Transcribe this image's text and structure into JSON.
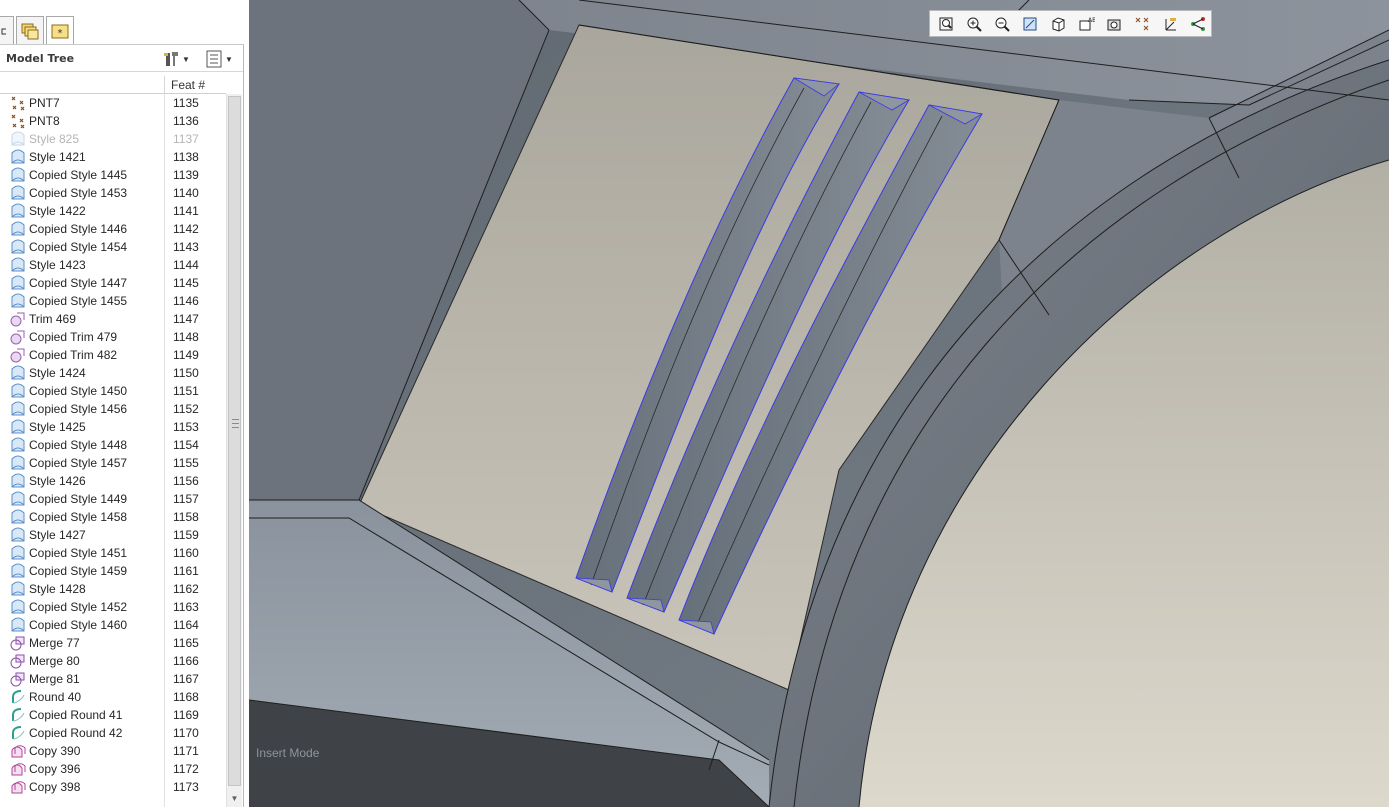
{
  "panel": {
    "header_title": "Model Tree",
    "feat_column_label": "Feat #"
  },
  "tree": {
    "rows": [
      {
        "name": "PNT7",
        "num": "1135",
        "icon": "datum-point-icon",
        "suppressed": false
      },
      {
        "name": "PNT8",
        "num": "1136",
        "icon": "datum-point-icon",
        "suppressed": false
      },
      {
        "name": "Style 825",
        "num": "1137",
        "icon": "style-icon",
        "suppressed": true
      },
      {
        "name": "Style 1421",
        "num": "1138",
        "icon": "style-icon",
        "suppressed": false
      },
      {
        "name": "Copied Style 1445",
        "num": "1139",
        "icon": "style-icon",
        "suppressed": false
      },
      {
        "name": "Copied Style 1453",
        "num": "1140",
        "icon": "style-icon",
        "suppressed": false
      },
      {
        "name": "Style 1422",
        "num": "1141",
        "icon": "style-icon",
        "suppressed": false
      },
      {
        "name": "Copied Style 1446",
        "num": "1142",
        "icon": "style-icon",
        "suppressed": false
      },
      {
        "name": "Copied Style 1454",
        "num": "1143",
        "icon": "style-icon",
        "suppressed": false
      },
      {
        "name": "Style 1423",
        "num": "1144",
        "icon": "style-icon",
        "suppressed": false
      },
      {
        "name": "Copied Style 1447",
        "num": "1145",
        "icon": "style-icon",
        "suppressed": false
      },
      {
        "name": "Copied Style 1455",
        "num": "1146",
        "icon": "style-icon",
        "suppressed": false
      },
      {
        "name": "Trim 469",
        "num": "1147",
        "icon": "trim-icon",
        "suppressed": false
      },
      {
        "name": "Copied Trim 479",
        "num": "1148",
        "icon": "trim-icon",
        "suppressed": false
      },
      {
        "name": "Copied Trim 482",
        "num": "1149",
        "icon": "trim-icon",
        "suppressed": false
      },
      {
        "name": "Style 1424",
        "num": "1150",
        "icon": "style-icon",
        "suppressed": false
      },
      {
        "name": "Copied Style 1450",
        "num": "1151",
        "icon": "style-icon",
        "suppressed": false
      },
      {
        "name": "Copied Style 1456",
        "num": "1152",
        "icon": "style-icon",
        "suppressed": false
      },
      {
        "name": "Style 1425",
        "num": "1153",
        "icon": "style-icon",
        "suppressed": false
      },
      {
        "name": "Copied Style 1448",
        "num": "1154",
        "icon": "style-icon",
        "suppressed": false
      },
      {
        "name": "Copied Style 1457",
        "num": "1155",
        "icon": "style-icon",
        "suppressed": false
      },
      {
        "name": "Style 1426",
        "num": "1156",
        "icon": "style-icon",
        "suppressed": false
      },
      {
        "name": "Copied Style 1449",
        "num": "1157",
        "icon": "style-icon",
        "suppressed": false
      },
      {
        "name": "Copied Style 1458",
        "num": "1158",
        "icon": "style-icon",
        "suppressed": false
      },
      {
        "name": "Style 1427",
        "num": "1159",
        "icon": "style-icon",
        "suppressed": false
      },
      {
        "name": "Copied Style 1451",
        "num": "1160",
        "icon": "style-icon",
        "suppressed": false
      },
      {
        "name": "Copied Style 1459",
        "num": "1161",
        "icon": "style-icon",
        "suppressed": false
      },
      {
        "name": "Style 1428",
        "num": "1162",
        "icon": "style-icon",
        "suppressed": false
      },
      {
        "name": "Copied Style 1452",
        "num": "1163",
        "icon": "style-icon",
        "suppressed": false
      },
      {
        "name": "Copied Style 1460",
        "num": "1164",
        "icon": "style-icon",
        "suppressed": false
      },
      {
        "name": "Merge 77",
        "num": "1165",
        "icon": "merge-icon",
        "suppressed": false
      },
      {
        "name": "Merge 80",
        "num": "1166",
        "icon": "merge-icon",
        "suppressed": false
      },
      {
        "name": "Merge 81",
        "num": "1167",
        "icon": "merge-icon",
        "suppressed": false
      },
      {
        "name": "Round 40",
        "num": "1168",
        "icon": "round-icon",
        "suppressed": false
      },
      {
        "name": "Copied Round 41",
        "num": "1169",
        "icon": "round-icon",
        "suppressed": false
      },
      {
        "name": "Copied Round 42",
        "num": "1170",
        "icon": "round-icon",
        "suppressed": false
      },
      {
        "name": "Copy 390",
        "num": "1171",
        "icon": "copy-icon",
        "suppressed": false
      },
      {
        "name": "Copy 396",
        "num": "1172",
        "icon": "copy-icon",
        "suppressed": false
      },
      {
        "name": "Copy 398",
        "num": "1173",
        "icon": "copy-icon",
        "suppressed": false
      }
    ]
  },
  "viewport": {
    "status_text": "Insert Mode",
    "toolbar_icons": [
      "refit-icon",
      "zoom-in-icon",
      "zoom-out-icon",
      "repaint-icon",
      "display-style-icon",
      "saved-views-icon",
      "view-manager-icon",
      "datum-points-display-icon",
      "coordinate-systems-display-icon",
      "annotations-display-icon"
    ]
  },
  "colors": {
    "style_icon": "#5b8fc8",
    "trim_icon": "#9a5fb0",
    "merge_icon": "#8a4fa8",
    "round_icon": "#2e9e8e",
    "copy_icon": "#b0469a",
    "point_icon": "#8a4a1a",
    "edge_highlight": "#4646e6"
  }
}
